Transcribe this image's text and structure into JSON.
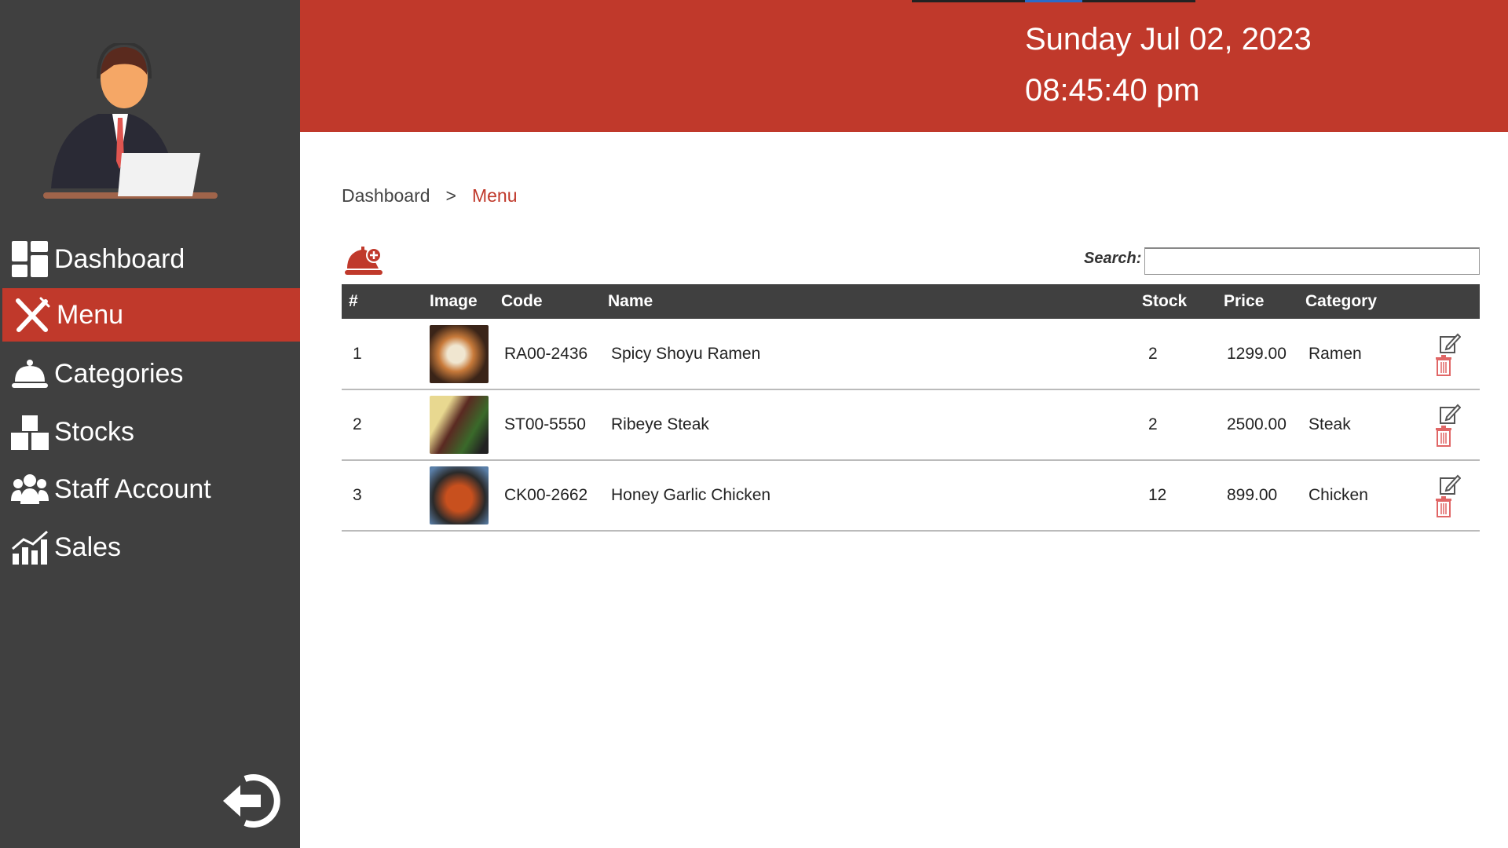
{
  "header": {
    "date": "Sunday Jul 02, 2023",
    "time": "08:45:40 pm"
  },
  "sidebar": {
    "items": [
      {
        "label": "Dashboard",
        "icon": "dashboard-icon"
      },
      {
        "label": "Menu",
        "icon": "utensils-icon"
      },
      {
        "label": "Categories",
        "icon": "cloche-icon"
      },
      {
        "label": "Stocks",
        "icon": "boxes-icon"
      },
      {
        "label": "Staff Account",
        "icon": "users-icon"
      },
      {
        "label": "Sales",
        "icon": "chart-icon"
      }
    ],
    "active": "Menu"
  },
  "breadcrumb": {
    "root": "Dashboard",
    "sep": ">",
    "current": "Menu"
  },
  "search": {
    "label": "Search:",
    "value": ""
  },
  "table": {
    "headers": [
      "#",
      "Image",
      "Code",
      "Name",
      "Stock",
      "Price",
      "Category"
    ],
    "rows": [
      {
        "n": "1",
        "code": "RA00-2436",
        "name": "Spicy Shoyu Ramen",
        "stock": "2",
        "price": "1299.00",
        "category": "Ramen"
      },
      {
        "n": "2",
        "code": "ST00-5550",
        "name": "Ribeye Steak",
        "stock": "2",
        "price": "2500.00",
        "category": "Steak"
      },
      {
        "n": "3",
        "code": "CK00-2662",
        "name": "Honey Garlic Chicken",
        "stock": "12",
        "price": "899.00",
        "category": "Chicken"
      }
    ]
  },
  "colors": {
    "accent": "#c0392b",
    "sidebar": "#404040"
  }
}
